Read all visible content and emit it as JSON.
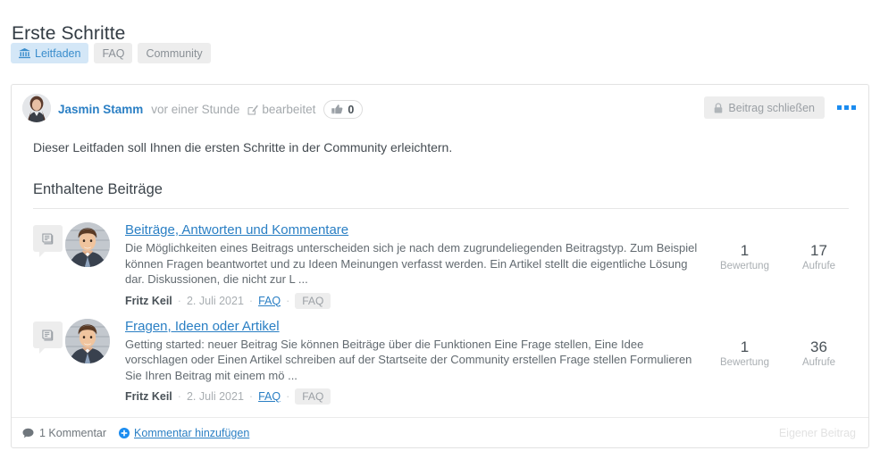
{
  "page": {
    "title": "Erste Schritte",
    "tags": [
      {
        "label": "Leitfaden",
        "icon": "bank-icon",
        "active": true
      },
      {
        "label": "FAQ",
        "icon": "",
        "active": false
      },
      {
        "label": "Community",
        "icon": "",
        "active": false
      }
    ]
  },
  "post": {
    "author": "Jasmin Stamm",
    "time_ago": "vor einer Stunde",
    "edited_label": "bearbeitet",
    "like_count": "0",
    "close_button": "Beitrag schließen",
    "menu_icon": "ellipsis-icon",
    "intro": "Dieser Leitfaden soll Ihnen die ersten Schritte in der Community erleichtern.",
    "section_title": "Enthaltene Beiträge"
  },
  "items": [
    {
      "title": "Beiträge, Antworten und Kommentare",
      "excerpt": "Die Möglichkeiten eines Beitrags unterscheiden sich je nach dem zugrundeliegenden Beitragstyp. Zum Beispiel können Fragen beantwortet und zu Ideen Meinungen verfasst werden. Ein Artikel stellt die eigentliche Lösung dar. Diskussionen, die nicht zur L ...",
      "meta": {
        "author": "Fritz Keil",
        "date": "2. Juli 2021",
        "link": "FAQ",
        "badge": "FAQ"
      },
      "stats": [
        {
          "value": "1",
          "label": "Bewertung"
        },
        {
          "value": "17",
          "label": "Aufrufe"
        }
      ]
    },
    {
      "title": "Fragen, Ideen oder Artikel",
      "excerpt": "Getting started: neuer Beitrag Sie können Beiträge über die Funktionen Eine Frage stellen, Eine Idee vorschlagen oder Einen Artikel schreiben auf der Startseite der Community erstellen Frage stellen  Formulieren Sie Ihren Beitrag mit einem mö ...",
      "meta": {
        "author": "Fritz Keil",
        "date": "2. Juli 2021",
        "link": "FAQ",
        "badge": "FAQ"
      },
      "stats": [
        {
          "value": "1",
          "label": "Bewertung"
        },
        {
          "value": "36",
          "label": "Aufrufe"
        }
      ]
    }
  ],
  "footer": {
    "comment_count": "1 Kommentar",
    "add_comment": "Kommentar hinzufügen",
    "own_post": "Eigener Beitrag"
  },
  "colors": {
    "link": "#2a7fc4",
    "accent": "#1b8cf0",
    "tag_active_bg": "#d4e7f7",
    "tag_bg": "#ededed",
    "muted": "#a9aeb2"
  }
}
